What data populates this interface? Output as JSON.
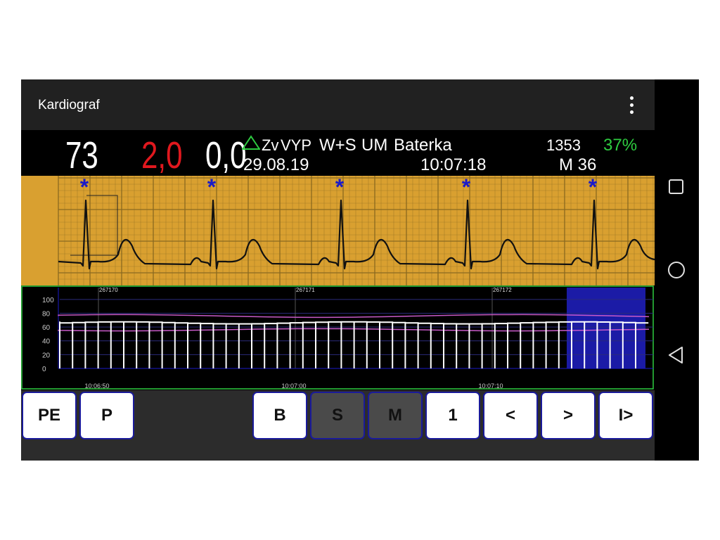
{
  "app": {
    "title": "Kardiograf"
  },
  "stats": {
    "heart_rate": "73",
    "value_red": "2,0",
    "value_white": "0,0",
    "zv_label": "Zv",
    "vyp_label": "VYP",
    "mode_label": "W+S",
    "um_label": "UM",
    "battery_label": "Baterka",
    "count": "1353",
    "battery_percent": "37%",
    "date": "29.08.19",
    "time": "10:07:18",
    "memory": "M 36"
  },
  "trend": {
    "y_ticks": [
      "100",
      "80",
      "60",
      "40",
      "20",
      "0"
    ],
    "beat_markers": [
      "267170",
      "267171",
      "267172"
    ],
    "time_labels": [
      "10:06:50",
      "10:07:00",
      "10:07:10"
    ]
  },
  "buttons": [
    {
      "label": "PE",
      "state": "normal"
    },
    {
      "label": "P",
      "state": "normal"
    },
    {
      "label": "B",
      "state": "normal"
    },
    {
      "label": "S",
      "state": "selected"
    },
    {
      "label": "M",
      "state": "selected"
    },
    {
      "label": "1",
      "state": "normal"
    },
    {
      "label": "<",
      "state": "normal"
    },
    {
      "label": ">",
      "state": "normal"
    },
    {
      "label": "I>",
      "state": "normal"
    }
  ],
  "colors": {
    "ecg_paper": "#d9a030",
    "grid": "#8a6a20",
    "beat_marker": "#1a1ac8",
    "red_value": "#e0181e",
    "battery_percent": "#2ecc40",
    "trend_border": "#2ecc40",
    "trend_selection": "#1e1eb8",
    "trend_curve": "#c85ac8",
    "button_border": "#1a1a9a",
    "button_selected": "#4a4a4a"
  },
  "icons": [
    "overflow-menu-icon",
    "nav-recents-icon",
    "nav-home-icon",
    "nav-back-icon",
    "triangle-icon"
  ]
}
